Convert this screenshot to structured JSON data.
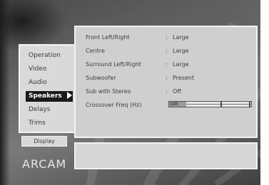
{
  "menu": {
    "items": [
      {
        "label": "Operation",
        "active": false
      },
      {
        "label": "Video",
        "active": false
      },
      {
        "label": "Audio",
        "active": false
      },
      {
        "label": "Speakers",
        "active": true
      },
      {
        "label": "Delays",
        "active": false
      },
      {
        "label": "Trims",
        "active": false
      }
    ]
  },
  "display_button": "Display",
  "settings": {
    "rows": [
      {
        "label": "Front Left/Right",
        "value": "Large"
      },
      {
        "label": "Centre",
        "value": "Large"
      },
      {
        "label": "Surround Left/Right",
        "value": "Large"
      },
      {
        "label": "Subwoofer",
        "value": "Present"
      },
      {
        "label": "Sub with Stereo",
        "value": "Off"
      },
      {
        "label": "Crossover Freq (Hz)",
        "value": ""
      }
    ],
    "separator": ":",
    "crossover_slider_value": "100"
  },
  "logo": "ARCAM"
}
